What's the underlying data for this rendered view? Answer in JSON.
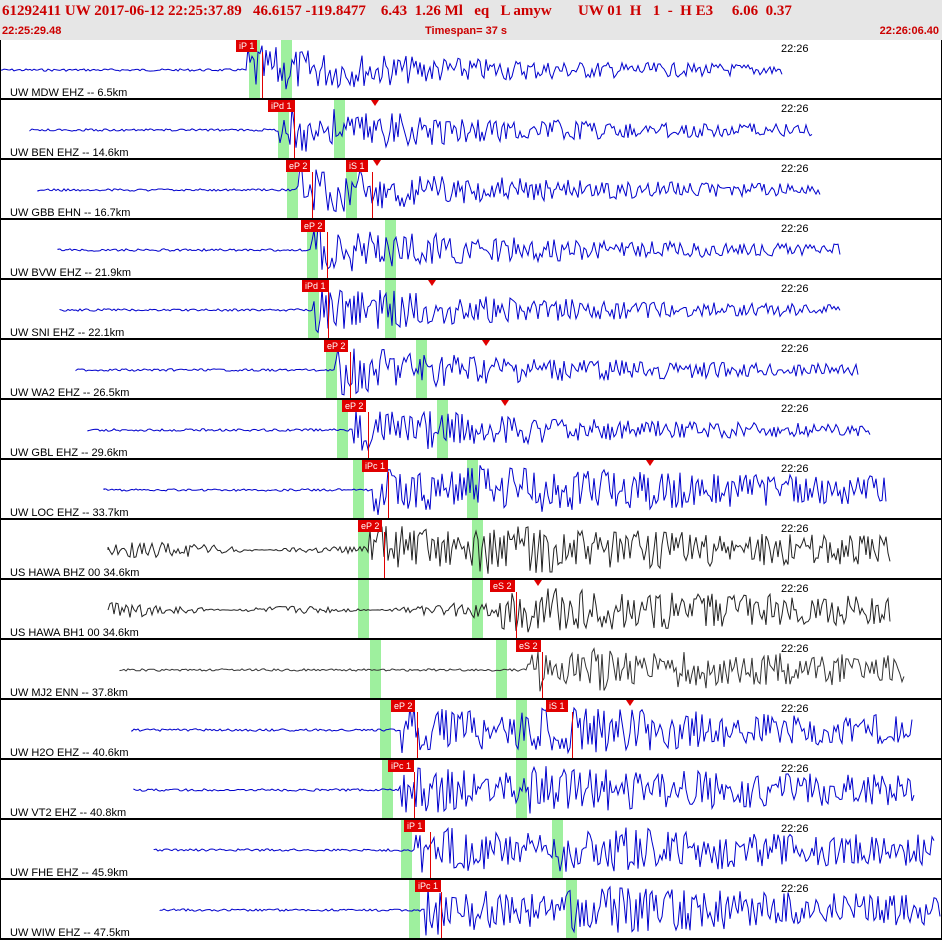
{
  "header": {
    "title_line": "61292411 UW 2017-06-12 22:25:37.89   46.6157 -119.8477    6.43  1.26 Ml   eq   L amyw       UW 01  H   1  -  H E3     6.06  0.37",
    "start_time": "22:25:29.48",
    "timespan": "Timespan=  37 s",
    "end_time": "22:26:06.40"
  },
  "colors": {
    "header_bg": "#e6e6e6",
    "header_text": "#cc0000",
    "pick": "#e00000",
    "green_band": "#9ef09e",
    "trace_blue": "#0000cc",
    "trace_black": "#222222"
  },
  "traces": [
    {
      "label": "UW MDW EHZ -- 6.5km",
      "time": "22:26",
      "color": "blue",
      "picks": [
        "iP 1"
      ]
    },
    {
      "label": "UW BEN EHZ -- 14.6km",
      "time": "22:26",
      "color": "blue",
      "picks": [
        "iPd 1"
      ]
    },
    {
      "label": "UW GBB EHN -- 16.7km",
      "time": "22:26",
      "color": "blue",
      "picks": [
        "eP 2",
        "iS 1"
      ]
    },
    {
      "label": "UW BVW EHZ -- 21.9km",
      "time": "22:26",
      "color": "blue",
      "picks": [
        "eP 2"
      ]
    },
    {
      "label": "UW SNI EHZ -- 22.1km",
      "time": "22:26",
      "color": "blue",
      "picks": [
        "iPd 1"
      ]
    },
    {
      "label": "UW WA2 EHZ -- 26.5km",
      "time": "22:26",
      "color": "blue",
      "picks": [
        "eP 2"
      ]
    },
    {
      "label": "UW GBL EHZ -- 29.6km",
      "time": "22:26",
      "color": "blue",
      "picks": [
        "eP 2"
      ]
    },
    {
      "label": "UW LOC EHZ -- 33.7km",
      "time": "22:26",
      "color": "blue",
      "picks": [
        "iPc 1"
      ]
    },
    {
      "label": "US HAWA BHZ 00 34.6km",
      "time": "22:26",
      "color": "black",
      "picks": [
        "eP 2"
      ]
    },
    {
      "label": "US HAWA BH1 00 34.6km",
      "time": "22:26",
      "color": "black",
      "picks": [
        "eS 2"
      ]
    },
    {
      "label": "UW MJ2 ENN -- 37.8km",
      "time": "22:26",
      "color": "darkgray",
      "picks": [
        "eS 2"
      ]
    },
    {
      "label": "UW H2O EHZ -- 40.6km",
      "time": "22:26",
      "color": "blue",
      "picks": [
        "eP 2",
        "iS 1"
      ]
    },
    {
      "label": "UW VT2 EHZ -- 40.8km",
      "time": "22:26",
      "color": "blue",
      "picks": [
        "iPc 1"
      ]
    },
    {
      "label": "UW FHE EHZ -- 45.9km",
      "time": "22:26",
      "color": "blue",
      "picks": [
        "iP 1"
      ]
    },
    {
      "label": "UW WIW EHZ -- 47.5km",
      "time": "22:26",
      "color": "blue",
      "picks": [
        "iPc 1"
      ]
    }
  ]
}
